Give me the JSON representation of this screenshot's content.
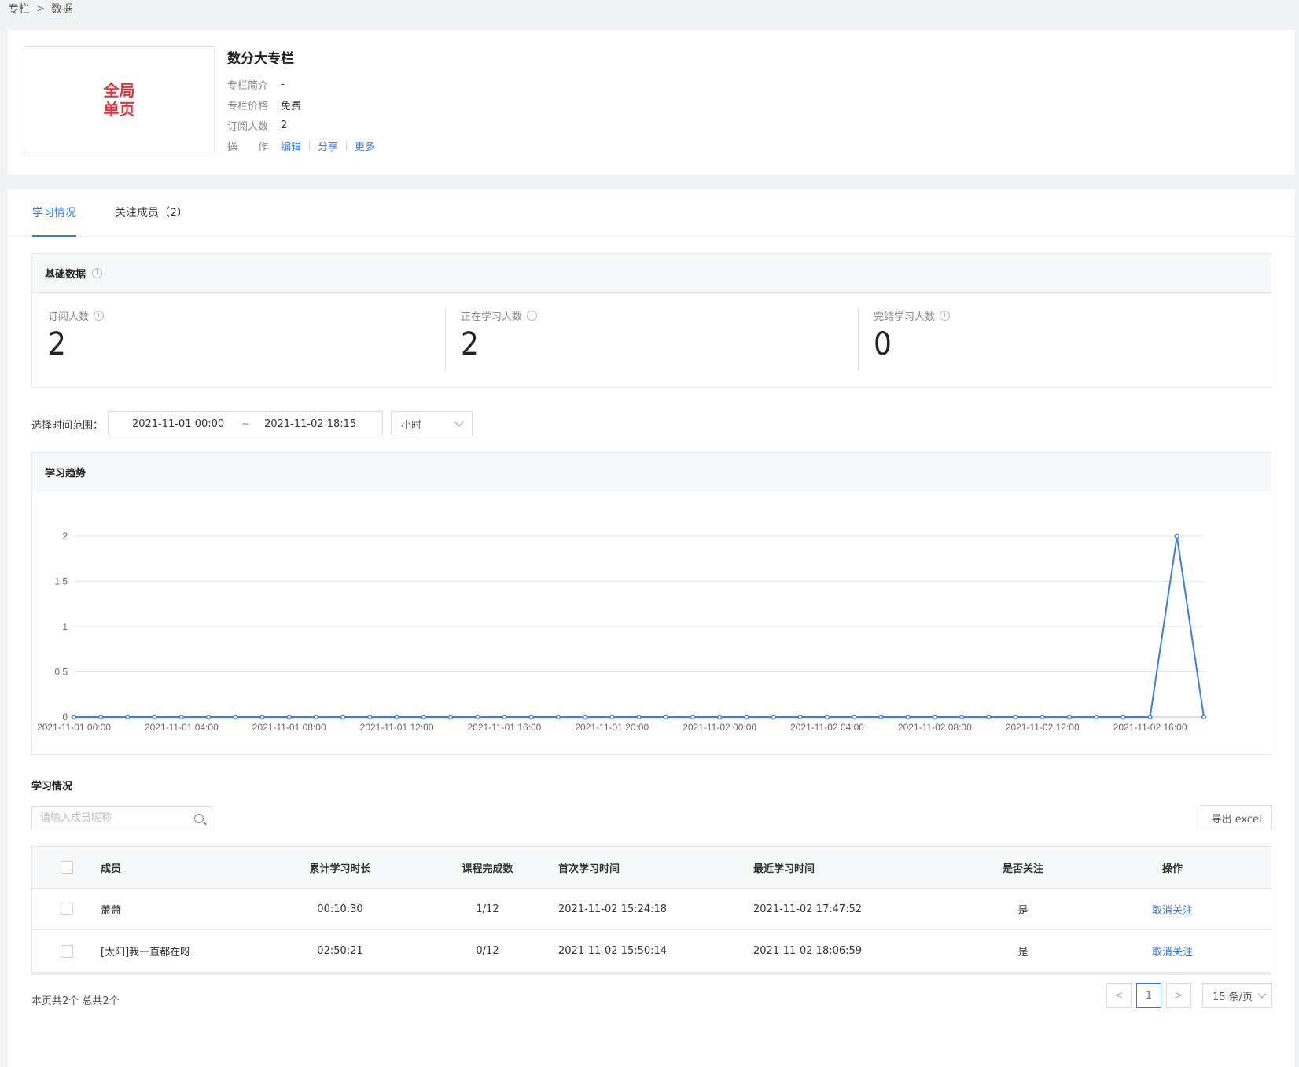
{
  "breadcrumb": {
    "items": [
      "专栏",
      "数据"
    ],
    "separator": ">"
  },
  "column": {
    "cover_line1": "全局",
    "cover_line2": "单页",
    "title": "数分大专栏",
    "intro_label": "专栏简介",
    "intro_value": "-",
    "price_label": "专栏价格",
    "price_value": "免费",
    "subs_label": "订阅人数",
    "subs_value": "2",
    "ops_label": "操　　作",
    "ops": {
      "edit": "编辑",
      "share": "分享",
      "more": "更多"
    }
  },
  "tabs": {
    "study": "学习情况",
    "members": "关注成员（2）"
  },
  "basic": {
    "title": "基础数据",
    "stats": [
      {
        "label": "订阅人数",
        "value": "2"
      },
      {
        "label": "正在学习人数",
        "value": "2"
      },
      {
        "label": "完结学习人数",
        "value": "0"
      }
    ]
  },
  "range": {
    "label": "选择时间范围：",
    "start": "2021-11-01 00:00",
    "tilde": "~",
    "end": "2021-11-02 18:15",
    "unit": "小时"
  },
  "trend": {
    "title": "学习趋势"
  },
  "chart_data": {
    "type": "line",
    "title": "",
    "xlabel": "",
    "ylabel": "",
    "ylim": [
      0,
      2
    ],
    "yticks": [
      "0",
      "0.5",
      "1",
      "1.5",
      "2"
    ],
    "x_tick_labels": [
      "2021-11-01 00:00",
      "2021-11-01 04:00",
      "2021-11-01 08:00",
      "2021-11-01 12:00",
      "2021-11-01 16:00",
      "2021-11-01 20:00",
      "2021-11-02 00:00",
      "2021-11-02 04:00",
      "2021-11-02 08:00",
      "2021-11-02 12:00",
      "2021-11-02 16:00"
    ],
    "x": [
      "2021-11-01 00:00",
      "2021-11-01 01:00",
      "2021-11-01 02:00",
      "2021-11-01 03:00",
      "2021-11-01 04:00",
      "2021-11-01 05:00",
      "2021-11-01 06:00",
      "2021-11-01 07:00",
      "2021-11-01 08:00",
      "2021-11-01 09:00",
      "2021-11-01 10:00",
      "2021-11-01 11:00",
      "2021-11-01 12:00",
      "2021-11-01 13:00",
      "2021-11-01 14:00",
      "2021-11-01 15:00",
      "2021-11-01 16:00",
      "2021-11-01 17:00",
      "2021-11-01 18:00",
      "2021-11-01 19:00",
      "2021-11-01 20:00",
      "2021-11-01 21:00",
      "2021-11-01 22:00",
      "2021-11-01 23:00",
      "2021-11-02 00:00",
      "2021-11-02 01:00",
      "2021-11-02 02:00",
      "2021-11-02 03:00",
      "2021-11-02 04:00",
      "2021-11-02 05:00",
      "2021-11-02 06:00",
      "2021-11-02 07:00",
      "2021-11-02 08:00",
      "2021-11-02 09:00",
      "2021-11-02 10:00",
      "2021-11-02 11:00",
      "2021-11-02 12:00",
      "2021-11-02 13:00",
      "2021-11-02 14:00",
      "2021-11-02 15:00",
      "2021-11-02 16:00",
      "2021-11-02 17:00",
      "2021-11-02 18:00"
    ],
    "series": [
      {
        "values": [
          0,
          0,
          0,
          0,
          0,
          0,
          0,
          0,
          0,
          0,
          0,
          0,
          0,
          0,
          0,
          0,
          0,
          0,
          0,
          0,
          0,
          0,
          0,
          0,
          0,
          0,
          0,
          0,
          0,
          0,
          0,
          0,
          0,
          0,
          0,
          0,
          0,
          0,
          0,
          0,
          0,
          2,
          0
        ]
      }
    ],
    "grid": true,
    "line_color": "#3b7fdd"
  },
  "study_section": {
    "title": "学习情况"
  },
  "search": {
    "placeholder": "请输入成员昵称"
  },
  "export_label": "导出 excel",
  "table": {
    "headers": {
      "member": "成员",
      "duration": "累计学习时长",
      "completed": "课程完成数",
      "first": "首次学习时间",
      "last": "最近学习时间",
      "following": "是否关注",
      "op": "操作"
    },
    "rows": [
      {
        "member": "萧萧",
        "duration": "00:10:30",
        "completed": "1/12",
        "first": "2021-11-02 15:24:18",
        "last": "2021-11-02 17:47:52",
        "following": "是",
        "op": "取消关注"
      },
      {
        "member": "[太阳]我一直都在呀",
        "duration": "02:50:21",
        "completed": "0/12",
        "first": "2021-11-02 15:50:14",
        "last": "2021-11-02 18:06:59",
        "following": "是",
        "op": "取消关注"
      }
    ]
  },
  "pagination": {
    "info": "本页共2个 总共2个",
    "prev": "<",
    "current": "1",
    "next": ">",
    "page_size": "15 条/页"
  }
}
